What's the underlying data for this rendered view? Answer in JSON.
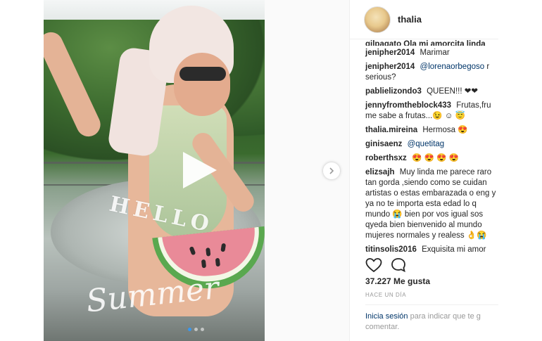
{
  "post": {
    "username": "thalia",
    "carousel_dots": 3,
    "active_dot": 1,
    "stickers": {
      "hello": "HELLO",
      "summer": "Summer"
    }
  },
  "comments": [
    {
      "user": "jenipher2014",
      "text": "Marimar"
    },
    {
      "user": "jenipher2014",
      "mention": "@lorenaorbegoso",
      "text": "r serious?"
    },
    {
      "user": "pablielizondo3",
      "text": "QUEEN!!! ❤❤"
    },
    {
      "user": "jennyfromtheblock433",
      "text": "Frutas,fru me sabe a frutas...😉 ☺ 😇"
    },
    {
      "user": "thalia.mireina",
      "text": "Hermosa 😍"
    },
    {
      "user": "ginisaenz",
      "mention": "@quetitag",
      "text": ""
    },
    {
      "user": "roberthsxz",
      "text": "😍 😍 😍 😍"
    },
    {
      "user": "elizsajh",
      "text": "Muy linda me parece raro tan gorda ,siendo como se cuidan artistas o estas embarazada o eng y ya no te importa esta edad lo q mundo 😭 bien por vos igual sos qyeda bien bienvenido al mundo mujeres normales y realess 👌😭"
    },
    {
      "user": "titinsolis2016",
      "text": "Exquisita mi amor"
    }
  ],
  "clipped_comment": "gilpagato  Ola mi amorcita linda",
  "likes": "37.227 Me gusta",
  "time_ago": "HACE UN DÍA",
  "login": {
    "link": "Inicia sesión",
    "text": "para indicar que te g comentar."
  },
  "icons": {
    "like": "heart-outline-icon",
    "comment": "speech-bubble-icon",
    "play": "play-icon",
    "next": "chevron-right-icon"
  },
  "colors": {
    "link": "#003569",
    "muted": "#999999",
    "text": "#262626",
    "active_dot": "#3897f0"
  }
}
